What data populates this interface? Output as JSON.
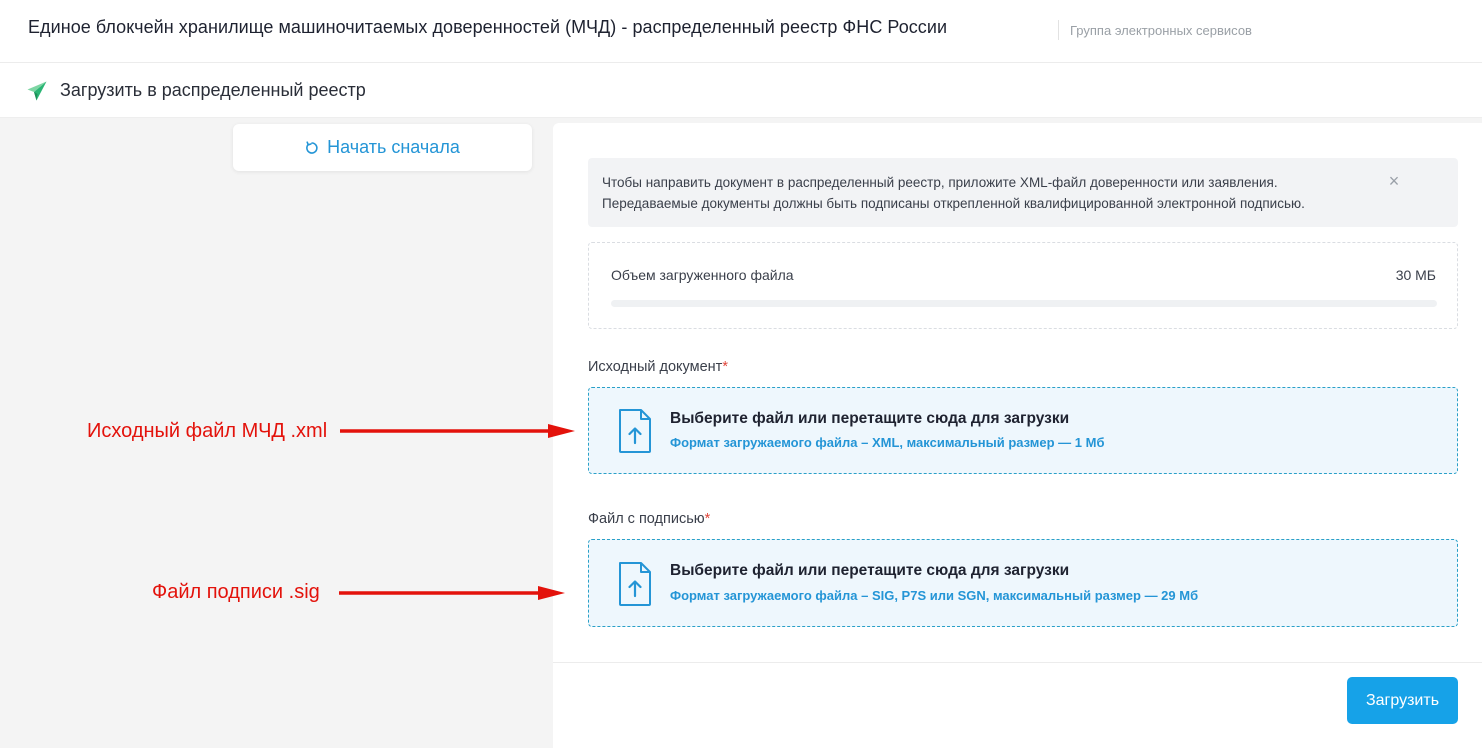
{
  "header": {
    "title": "Единое блокчейн хранилище машиночитаемых доверенностей (МЧД) - распределенный реестр ФНС России",
    "subtitle": "Группа электронных сервисов"
  },
  "section": {
    "icon": "paper-plane-icon",
    "title": "Загрузить в распределенный реестр"
  },
  "sidebar": {
    "restart_label": "Начать сначала",
    "restart_icon": "refresh-icon"
  },
  "notice": {
    "line1": "Чтобы направить документ в распределенный реестр, приложите XML-файл доверенности или заявления.",
    "line2": "Передаваемые документы должны быть подписаны открепленной квалифицированной электронной подписью.",
    "close_icon": "close-icon"
  },
  "upload_volume": {
    "label": "Объем загруженного файла",
    "max": "30 МБ",
    "progress_fraction": 0
  },
  "source_document": {
    "label": "Исходный документ",
    "required_mark": "*",
    "dropzone_title": "Выберите файл или перетащите сюда для загрузки",
    "dropzone_hint": "Формат загружаемого файла – XML, максимальный размер — 1 Мб",
    "icon": "file-upload-icon"
  },
  "signature_file": {
    "label": "Файл с подписью",
    "required_mark": "*",
    "dropzone_title": "Выберите файл или перетащите сюда для загрузки",
    "dropzone_hint": "Формат загружаемого файла – SIG, P7S или SGN, максимальный размер — 29 Мб",
    "icon": "file-upload-icon"
  },
  "actions": {
    "submit_label": "Загрузить"
  },
  "annotations": {
    "source_label": "Исходный файл МЧД .xml",
    "signature_label": "Файл подписи .sig",
    "color": "#e3120b"
  },
  "colors": {
    "accent": "#16a2e8",
    "link": "#2495d6",
    "dropzone_bg": "#eef7fd",
    "required": "#e0453a"
  }
}
